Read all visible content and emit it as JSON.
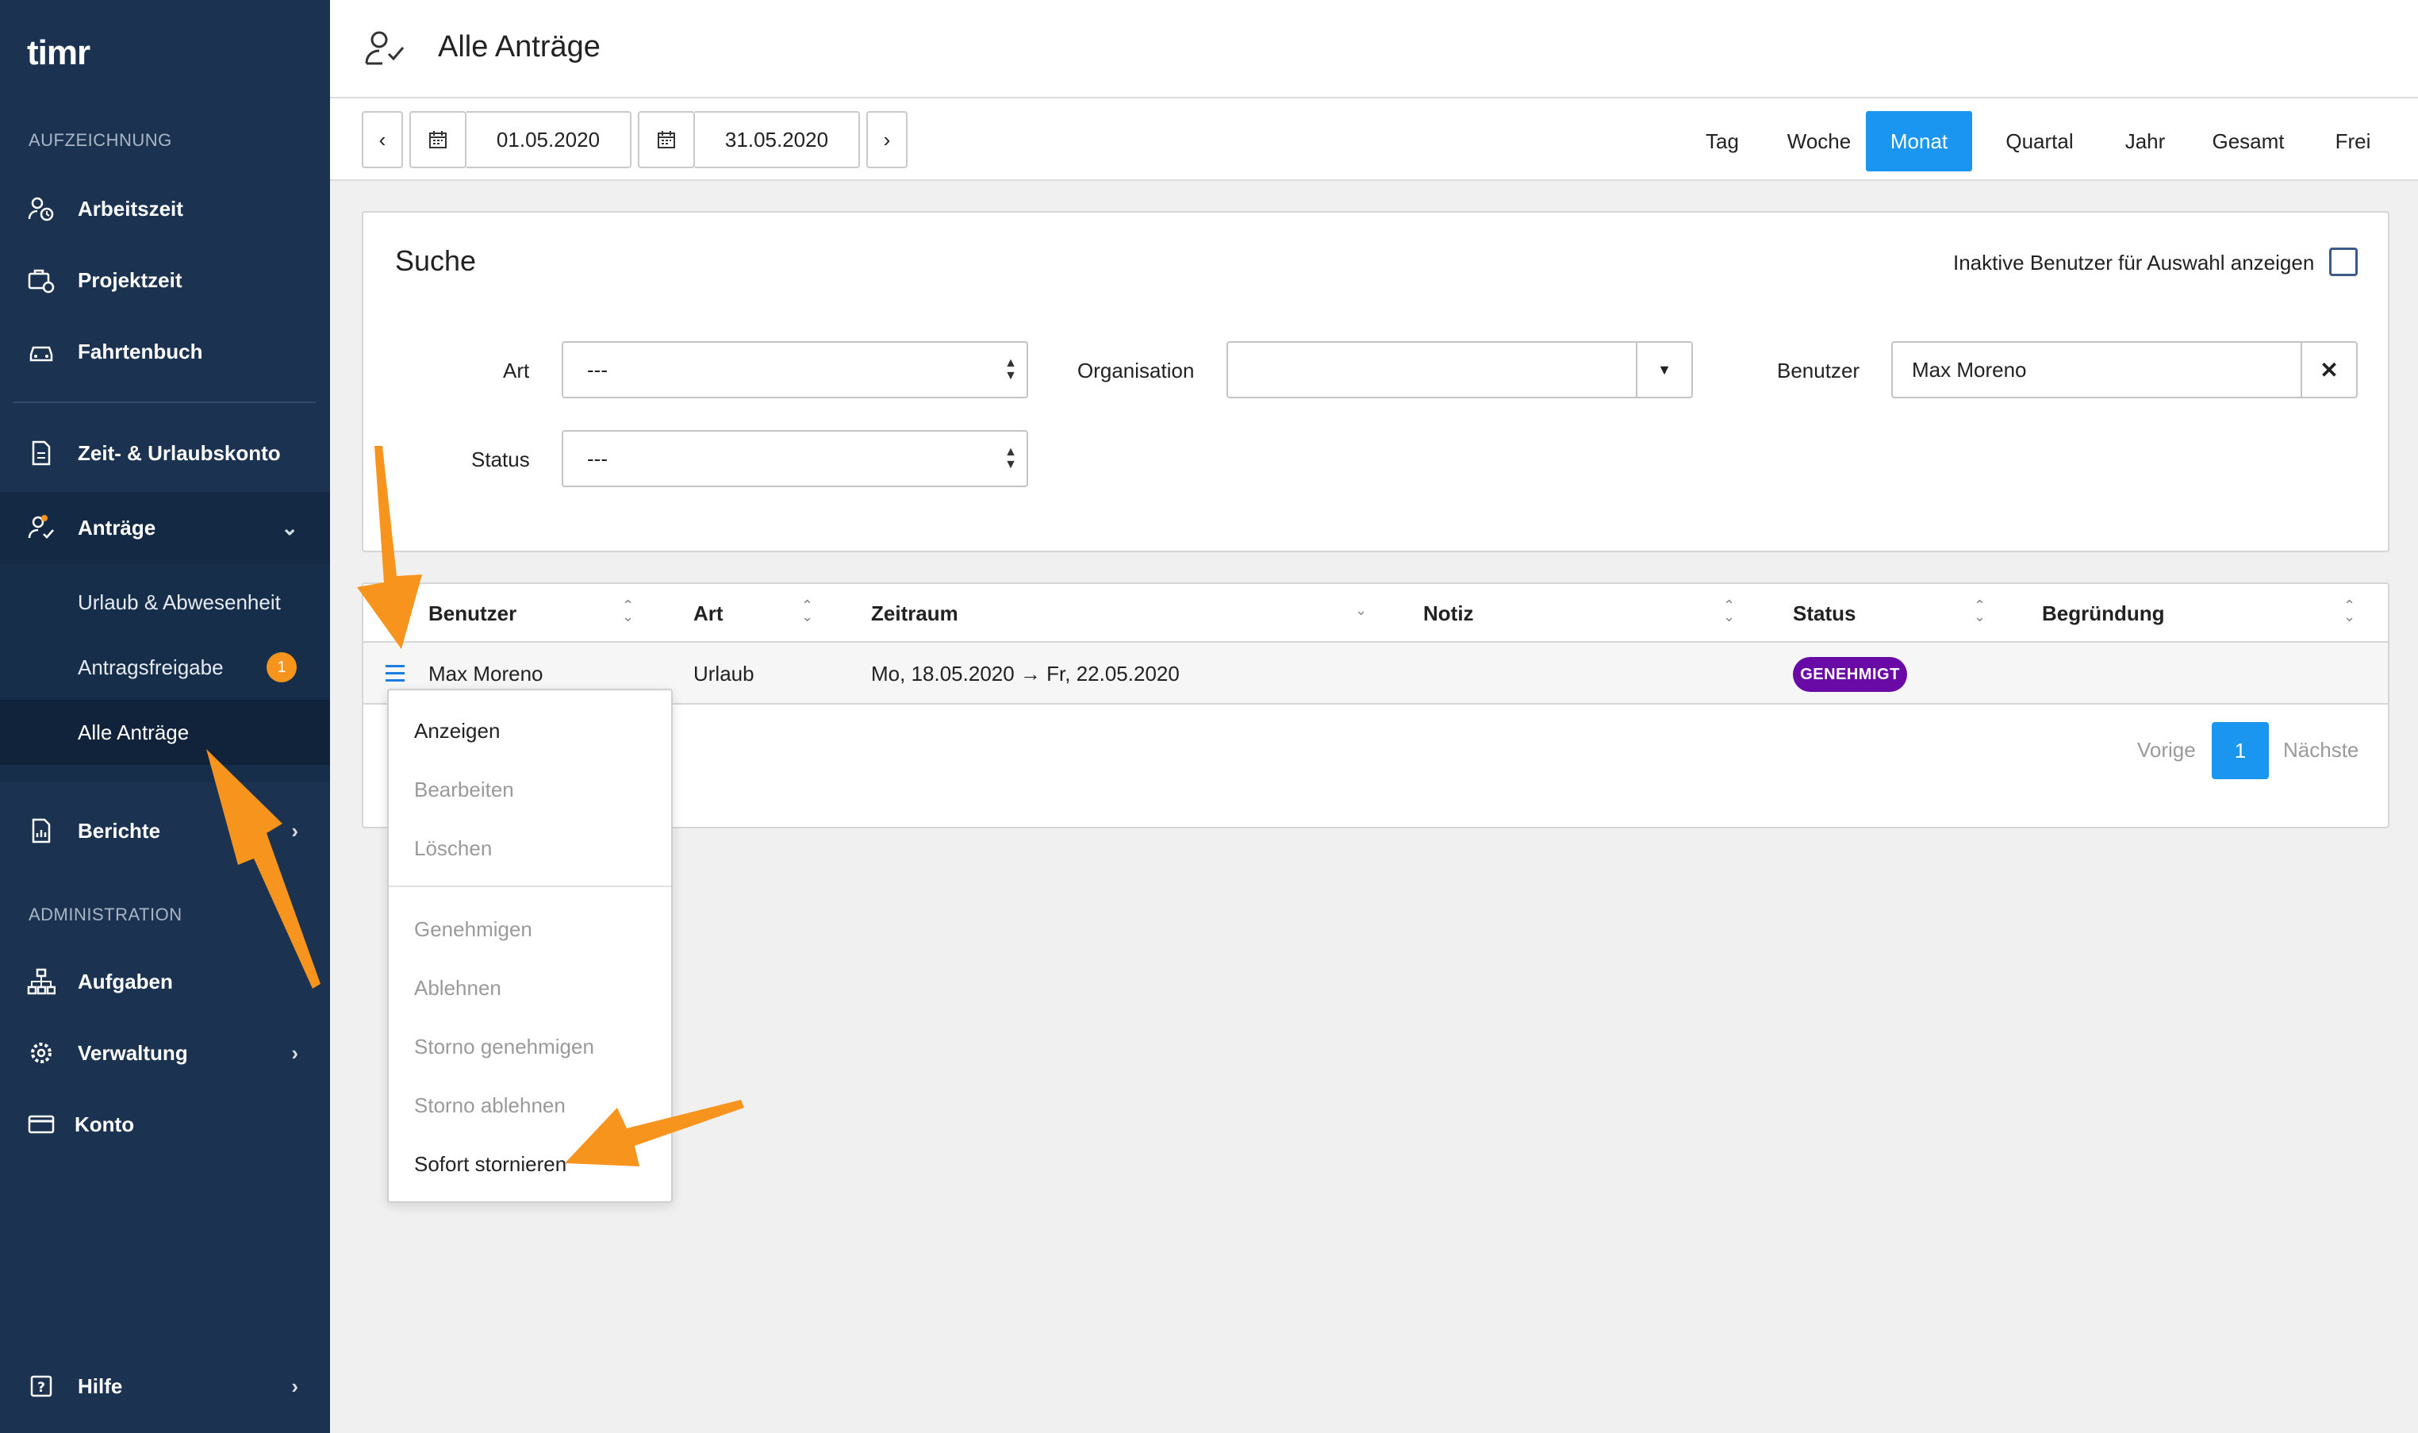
{
  "brand": {
    "logo_text": "timr"
  },
  "sidebar": {
    "section_recording": "AUFZEICHNUNG",
    "section_admin": "ADMINISTRATION",
    "items": [
      {
        "label": "Arbeitszeit",
        "icon": "clock-user-icon"
      },
      {
        "label": "Projektzeit",
        "icon": "briefcase-clock-icon"
      },
      {
        "label": "Fahrtenbuch",
        "icon": "car-icon"
      },
      {
        "label": "Zeit- & Urlaubskonto",
        "icon": "document-icon"
      },
      {
        "label": "Anträge",
        "icon": "user-check-icon",
        "expanded": true
      },
      {
        "label": "Berichte",
        "icon": "report-icon"
      },
      {
        "label": "Aufgaben",
        "icon": "hierarchy-icon"
      },
      {
        "label": "Verwaltung",
        "icon": "gear-icon"
      },
      {
        "label": "Konto",
        "icon": "credit-card-icon"
      },
      {
        "label": "Hilfe",
        "icon": "help-icon"
      }
    ],
    "subitems": [
      {
        "label": "Urlaub & Abwesenheit"
      },
      {
        "label": "Antragsfreigabe",
        "badge": "1"
      },
      {
        "label": "Alle Anträge",
        "active": true
      }
    ]
  },
  "header": {
    "title": "Alle Anträge"
  },
  "toolbar": {
    "date_from": "01.05.2020",
    "date_to": "31.05.2020",
    "ranges": [
      "Tag",
      "Woche",
      "Monat",
      "Quartal",
      "Jahr",
      "Gesamt",
      "Frei"
    ],
    "active_range": "Monat"
  },
  "search": {
    "title": "Suche",
    "inactive_users_label": "Inaktive Benutzer für Auswahl anzeigen",
    "art_label": "Art",
    "art_value": "---",
    "organisation_label": "Organisation",
    "organisation_value": "",
    "user_label": "Benutzer",
    "user_value": "Max Moreno",
    "status_label": "Status",
    "status_value": "---"
  },
  "table": {
    "columns": [
      "Benutzer",
      "Art",
      "Zeitraum",
      "Notiz",
      "Status",
      "Begründung"
    ],
    "rows": [
      {
        "benutzer": "Max Moreno",
        "art": "Urlaub",
        "zeitraum": "Mo, 18.05.2020 → Fr, 22.05.2020",
        "notiz": "",
        "status": "GENEHMIGT",
        "begruendung": ""
      }
    ]
  },
  "pagination": {
    "prev": "Vorige",
    "current": "1",
    "next": "Nächste"
  },
  "context_menu": {
    "items": [
      {
        "label": "Anzeigen",
        "enabled": true
      },
      {
        "label": "Bearbeiten",
        "enabled": false
      },
      {
        "label": "Löschen",
        "enabled": false
      },
      {
        "label": "Genehmigen",
        "enabled": false
      },
      {
        "label": "Ablehnen",
        "enabled": false
      },
      {
        "label": "Storno genehmigen",
        "enabled": false
      },
      {
        "label": "Storno ablehnen",
        "enabled": false
      },
      {
        "label": "Sofort stornieren",
        "enabled": true
      }
    ]
  },
  "colors": {
    "sidebar": "#1b3350",
    "sidebar_active": "#142a44",
    "accent": "#1a96f0",
    "badge": "#f7941d",
    "status_approved": "#6a0aa6",
    "annotation_arrow": "#f7941d"
  }
}
